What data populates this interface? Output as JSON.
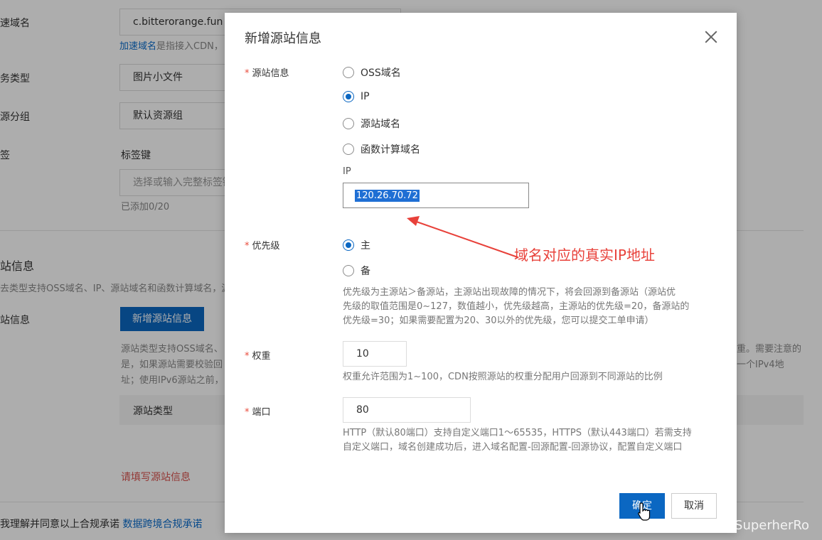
{
  "background": {
    "domain_label": "速域名",
    "domain_value": "c.bitterorange.fun",
    "domain_help_link": "加速域名",
    "domain_help_text": "是指接入CDN，",
    "biz_type_label": "务类型",
    "biz_type_value": "图片小文件",
    "res_group_label": "源分组",
    "res_group_value": "默认资源组",
    "tag_label": "签",
    "tag_key_label": "标签键",
    "tag_key_placeholder": "选择或输入完整标签键",
    "tag_count": "已添加0/20",
    "section_title": "站信息",
    "section_desc": "去类型支持OSS域名、IP、源站域名和函数计算域名，源",
    "origin_label": "站信息",
    "add_origin_button": "新增源站信息",
    "origin_desc_1": "源站类型支持OSS域名、",
    "origin_desc_2": "是，如果源站需要校验回",
    "origin_desc_3": "址；使用IPv6源站之前，",
    "origin_desc_right_1": "重。需要注意的",
    "origin_desc_right_2": "一个IPv4地",
    "table_col_type": "源站类型",
    "origin_error": "请填写源站信息",
    "agreement_text": "我理解并同意以上合规承诺",
    "agreement_link": "数据跨境合规承诺"
  },
  "dialog": {
    "title": "新增源站信息",
    "origin_info_label": "源站信息",
    "origin_types": [
      "OSS域名",
      "IP",
      "源站域名",
      "函数计算域名"
    ],
    "origin_selected": "IP",
    "ip_label": "IP",
    "ip_value": "120.26.70.72",
    "priority_label": "优先级",
    "priority_options": [
      "主",
      "备"
    ],
    "priority_selected": "主",
    "priority_help_1": "优先级为主源站＞备源站，主源站出现故障的情况下，将会回源到备源站（源站优",
    "priority_help_2": "先级的取值范围是0~127，数值越小，优先级越高，主源站的优先级=20，备源站的",
    "priority_help_3": "优先级=30；如果需要配置为20、30以外的优先级，您可以提交工单申请）",
    "weight_label": "权重",
    "weight_value": "10",
    "weight_help": "权重允许范围为1~100，CDN按照源站的权重分配用户回源到不同源站的比例",
    "port_label": "端口",
    "port_value": "80",
    "port_help_1": "HTTP（默认80端口）支持自定义端口1～65535，HTTPS（默认443端口）若需支持",
    "port_help_2": "自定义端口，域名创建成功后，进入域名配置-回源配置-回源协议，配置自定义端口",
    "ok_button": "确定",
    "cancel_button": "取消"
  },
  "annotation": {
    "text": "域名对应的真实IP地址",
    "color": "#e8413a"
  },
  "watermark": "CSDN @SuperherRo",
  "colors": {
    "primary": "#0b67c2",
    "required": "#e94b3c",
    "error": "#d9534f"
  }
}
